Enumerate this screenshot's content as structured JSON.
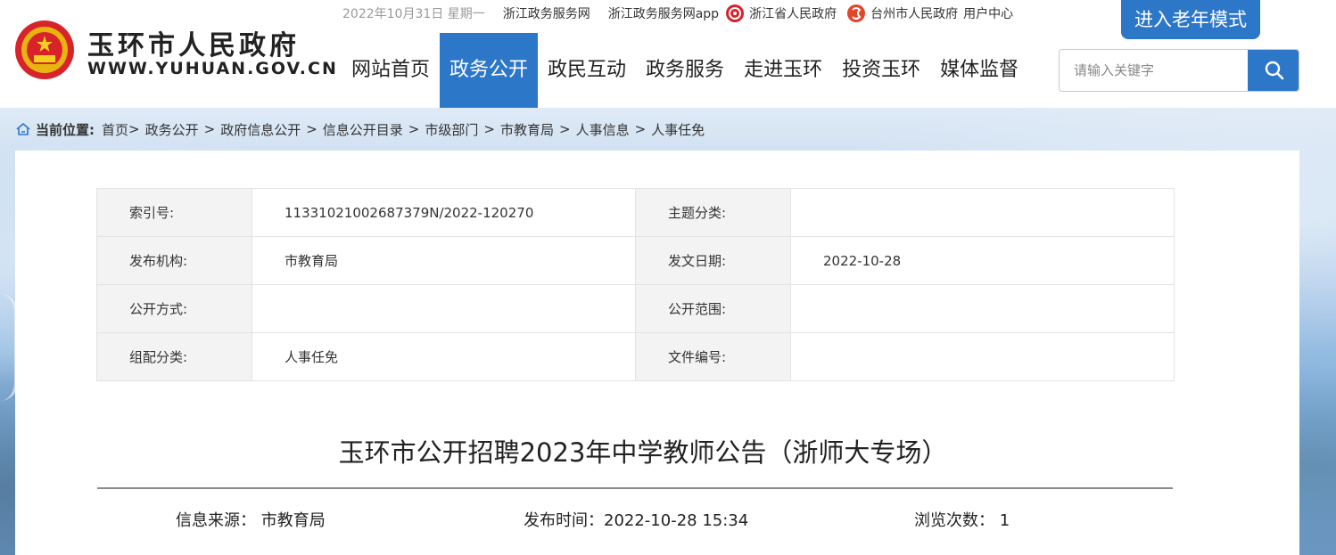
{
  "header": {
    "logo_cn": "玉环市人民政府",
    "logo_en": "WWW.YUHUAN.GOV.CN",
    "date": "2022年10月31日 星期一",
    "top_links": [
      "浙江政务服务网",
      "浙江政务服务网app",
      "浙江省人民政府",
      "台州市人民政府",
      "用户中心"
    ],
    "elder_mode": "进入老年模式",
    "nav": [
      "网站首页",
      "政务公开",
      "政民互动",
      "政务服务",
      "走进玉环",
      "投资玉环",
      "媒体监督"
    ],
    "search_placeholder": "请输入关键字"
  },
  "breadcrumb": {
    "label": "当前位置:",
    "items": [
      "首页",
      "政务公开",
      "政府信息公开",
      "信息公开目录",
      "市级部门",
      "市教育局",
      "人事信息",
      "人事任免"
    ]
  },
  "meta": {
    "rows": [
      {
        "k1": "索引号:",
        "v1": "11331021002687379N/2022-120270",
        "k2": "主题分类:",
        "v2": ""
      },
      {
        "k1": "发布机构:",
        "v1": "市教育局",
        "k2": "发文日期:",
        "v2": "2022-10-28"
      },
      {
        "k1": "公开方式:",
        "v1": "",
        "k2": "公开范围:",
        "v2": ""
      },
      {
        "k1": "组配分类:",
        "v1": "人事任免",
        "k2": "文件编号:",
        "v2": ""
      }
    ]
  },
  "article": {
    "title": "玉环市公开招聘2023年中学教师公告（浙师大专场）",
    "source_label": "信息来源：",
    "source": "市教育局",
    "time_label": "发布时间：",
    "time": "2022-10-28 15:34",
    "views_label": "浏览次数：",
    "views": "1"
  }
}
